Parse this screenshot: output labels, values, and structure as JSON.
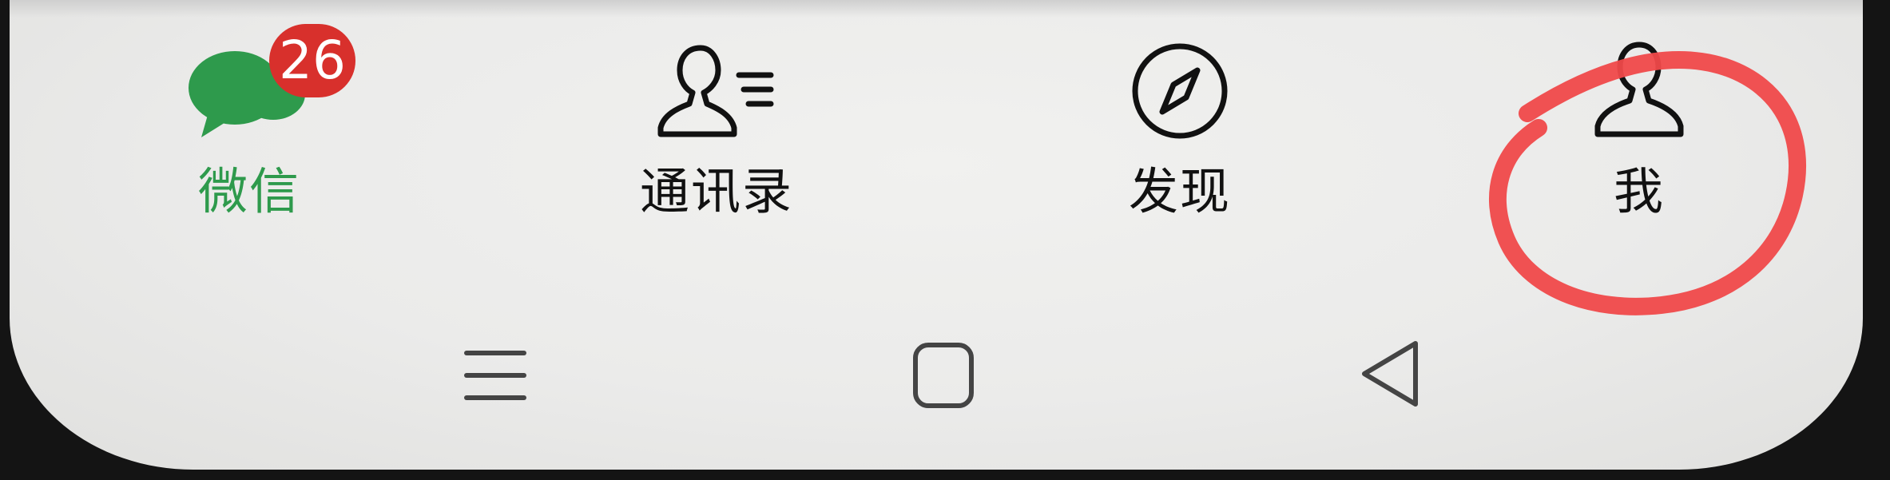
{
  "tabbar": {
    "active_tab": "chats",
    "tabs": [
      {
        "id": "chats",
        "label": "微信",
        "icon": "chat-bubbles-icon",
        "badge": "26"
      },
      {
        "id": "contacts",
        "label": "通讯录",
        "icon": "contacts-icon"
      },
      {
        "id": "discover",
        "label": "发现",
        "icon": "compass-icon"
      },
      {
        "id": "me",
        "label": "我",
        "icon": "person-icon"
      }
    ]
  },
  "system_nav": {
    "buttons": [
      {
        "id": "menu",
        "icon": "menu-lines-icon"
      },
      {
        "id": "home",
        "icon": "square-home-icon"
      },
      {
        "id": "back",
        "icon": "triangle-back-icon"
      }
    ]
  },
  "colors": {
    "accent_green": "#2e9a4c",
    "badge_red": "#d8302c",
    "annotation_red": "#f0494a",
    "text_dark": "#111111"
  },
  "annotation": {
    "shape": "hand-drawn circle",
    "target": "tab-me"
  }
}
